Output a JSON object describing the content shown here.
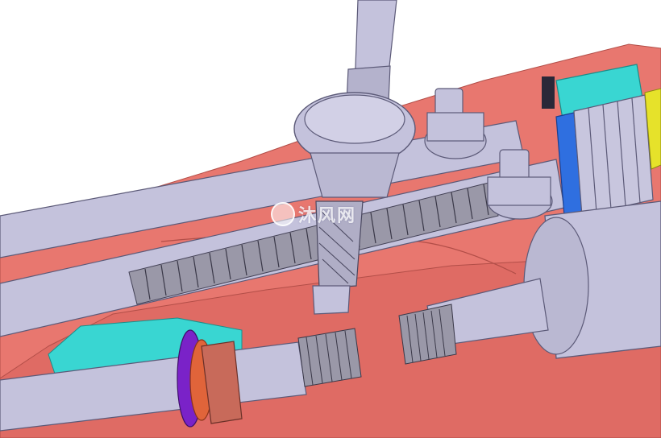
{
  "scene": {
    "subject": "steering-rack-and-pinion-assembly-cad-render",
    "colors": {
      "background": "#ffffff",
      "housing": "#e8776f",
      "housing_shade": "#cf5f58",
      "steel": "#c4c2dc",
      "steel_shade": "#8f8cb0",
      "rack_teeth": "#9a98a8",
      "boot_cyan": "#39d6d2",
      "bearing_blue": "#2f6fe0",
      "ring_purple": "#7a22c8",
      "ring_orange": "#e0643a",
      "accent_yellow": "#e6e22a"
    }
  },
  "watermark": {
    "text": "沐风网"
  }
}
